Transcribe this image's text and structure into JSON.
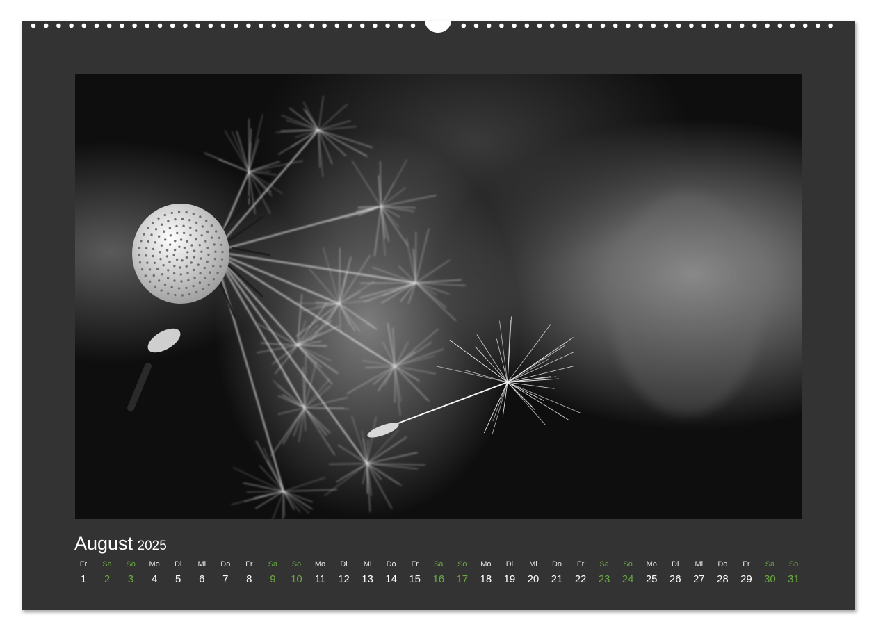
{
  "calendar": {
    "month": "August",
    "year": "2025",
    "weekend_color": "#6aa843",
    "text_color": "#ffffff",
    "page_background": "#333333",
    "photo_description_icon": "dandelion-photo",
    "days": [
      {
        "dow": "Fr",
        "num": "1",
        "weekend": false
      },
      {
        "dow": "Sa",
        "num": "2",
        "weekend": true
      },
      {
        "dow": "So",
        "num": "3",
        "weekend": true
      },
      {
        "dow": "Mo",
        "num": "4",
        "weekend": false
      },
      {
        "dow": "Di",
        "num": "5",
        "weekend": false
      },
      {
        "dow": "Mi",
        "num": "6",
        "weekend": false
      },
      {
        "dow": "Do",
        "num": "7",
        "weekend": false
      },
      {
        "dow": "Fr",
        "num": "8",
        "weekend": false
      },
      {
        "dow": "Sa",
        "num": "9",
        "weekend": true
      },
      {
        "dow": "So",
        "num": "10",
        "weekend": true
      },
      {
        "dow": "Mo",
        "num": "11",
        "weekend": false
      },
      {
        "dow": "Di",
        "num": "12",
        "weekend": false
      },
      {
        "dow": "Mi",
        "num": "13",
        "weekend": false
      },
      {
        "dow": "Do",
        "num": "14",
        "weekend": false
      },
      {
        "dow": "Fr",
        "num": "15",
        "weekend": false
      },
      {
        "dow": "Sa",
        "num": "16",
        "weekend": true
      },
      {
        "dow": "So",
        "num": "17",
        "weekend": true
      },
      {
        "dow": "Mo",
        "num": "18",
        "weekend": false
      },
      {
        "dow": "Di",
        "num": "19",
        "weekend": false
      },
      {
        "dow": "Mi",
        "num": "20",
        "weekend": false
      },
      {
        "dow": "Do",
        "num": "21",
        "weekend": false
      },
      {
        "dow": "Fr",
        "num": "22",
        "weekend": false
      },
      {
        "dow": "Sa",
        "num": "23",
        "weekend": true
      },
      {
        "dow": "So",
        "num": "24",
        "weekend": true
      },
      {
        "dow": "Mo",
        "num": "25",
        "weekend": false
      },
      {
        "dow": "Di",
        "num": "26",
        "weekend": false
      },
      {
        "dow": "Mi",
        "num": "27",
        "weekend": false
      },
      {
        "dow": "Do",
        "num": "28",
        "weekend": false
      },
      {
        "dow": "Fr",
        "num": "29",
        "weekend": false
      },
      {
        "dow": "Sa",
        "num": "30",
        "weekend": true
      },
      {
        "dow": "So",
        "num": "31",
        "weekend": true
      }
    ]
  }
}
